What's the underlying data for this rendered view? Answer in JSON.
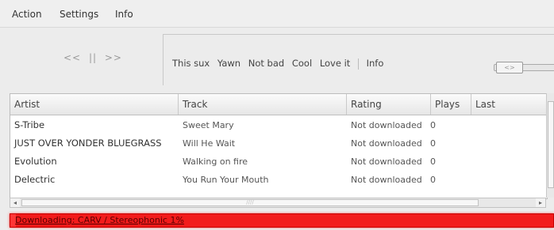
{
  "menu": {
    "items": [
      {
        "label": "Action"
      },
      {
        "label": "Settings"
      },
      {
        "label": "Info"
      }
    ]
  },
  "transport": {
    "prev": "<<",
    "pause": "||",
    "next": ">>"
  },
  "rating_buttons": {
    "this_sux": "This sux",
    "yawn": "Yawn",
    "not_bad": "Not bad",
    "cool": "Cool",
    "love_it": "Love it",
    "info": "Info"
  },
  "slider": {
    "thumb_label": "<>"
  },
  "table": {
    "columns": [
      "Artist",
      "Track",
      "Rating",
      "Plays",
      "Last"
    ],
    "rows": [
      {
        "artist": "S-Tribe",
        "track": "Sweet Mary",
        "rating": "Not downloaded",
        "plays": "0",
        "last": ""
      },
      {
        "artist": "JUST OVER YONDER BLUEGRASS",
        "track": "Will He Wait",
        "rating": "Not downloaded",
        "plays": "0",
        "last": ""
      },
      {
        "artist": "Evolution",
        "track": "Walking on fire",
        "rating": "Not downloaded",
        "plays": "0",
        "last": ""
      },
      {
        "artist": "Delectric",
        "track": "You Run Your Mouth",
        "rating": "Not downloaded",
        "plays": "0",
        "last": ""
      }
    ]
  },
  "hscroll": {
    "left_arrow": "◂",
    "right_arrow": "▸",
    "grip": "////"
  },
  "status": {
    "text": "Downloading: CARV / Stereophonic 1%",
    "progress_percent": 1,
    "bar_color": "#f21b1b"
  }
}
